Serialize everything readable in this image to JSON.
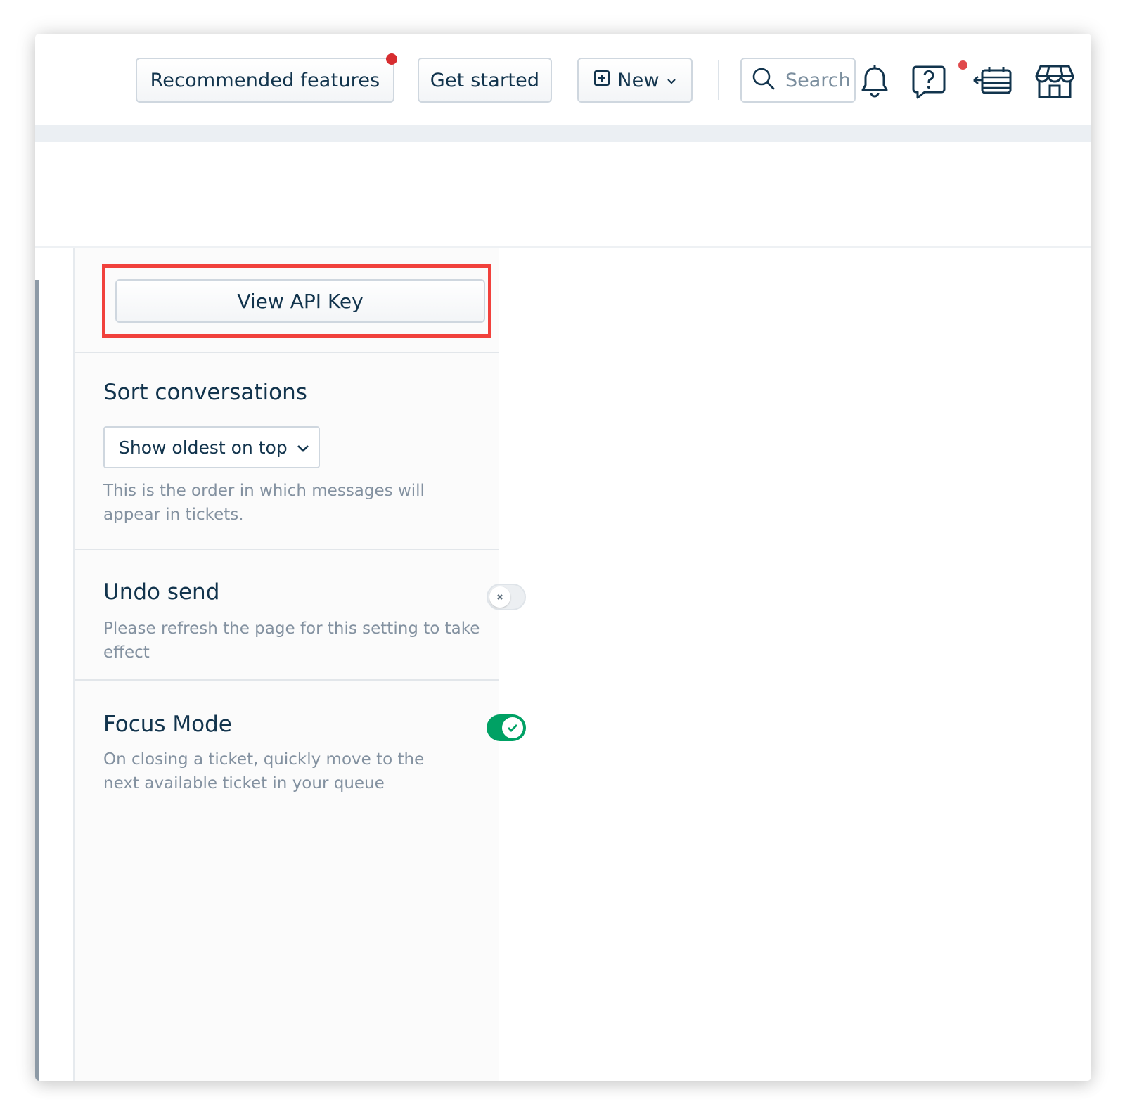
{
  "topbar": {
    "recommended_label": "Recommended features",
    "get_started_label": "Get started",
    "new_label": "New",
    "search_placeholder": "Search"
  },
  "settings": {
    "api_key_button": "View API Key",
    "sort": {
      "title": "Sort conversations",
      "selected": "Show oldest on top",
      "hint": "This is the order in which messages will appear in tickets."
    },
    "undo_send": {
      "title": "Undo send",
      "hint": "Please refresh the page for this setting to take effect",
      "enabled": false
    },
    "focus_mode": {
      "title": "Focus Mode",
      "hint": "On closing a ticket, quickly move to the next available ticket in your queue",
      "enabled": true
    }
  },
  "colors": {
    "highlight": "#f1413c",
    "notification_dot": "#d72d30",
    "toggle_on": "#00a164",
    "text": "#12344d"
  }
}
